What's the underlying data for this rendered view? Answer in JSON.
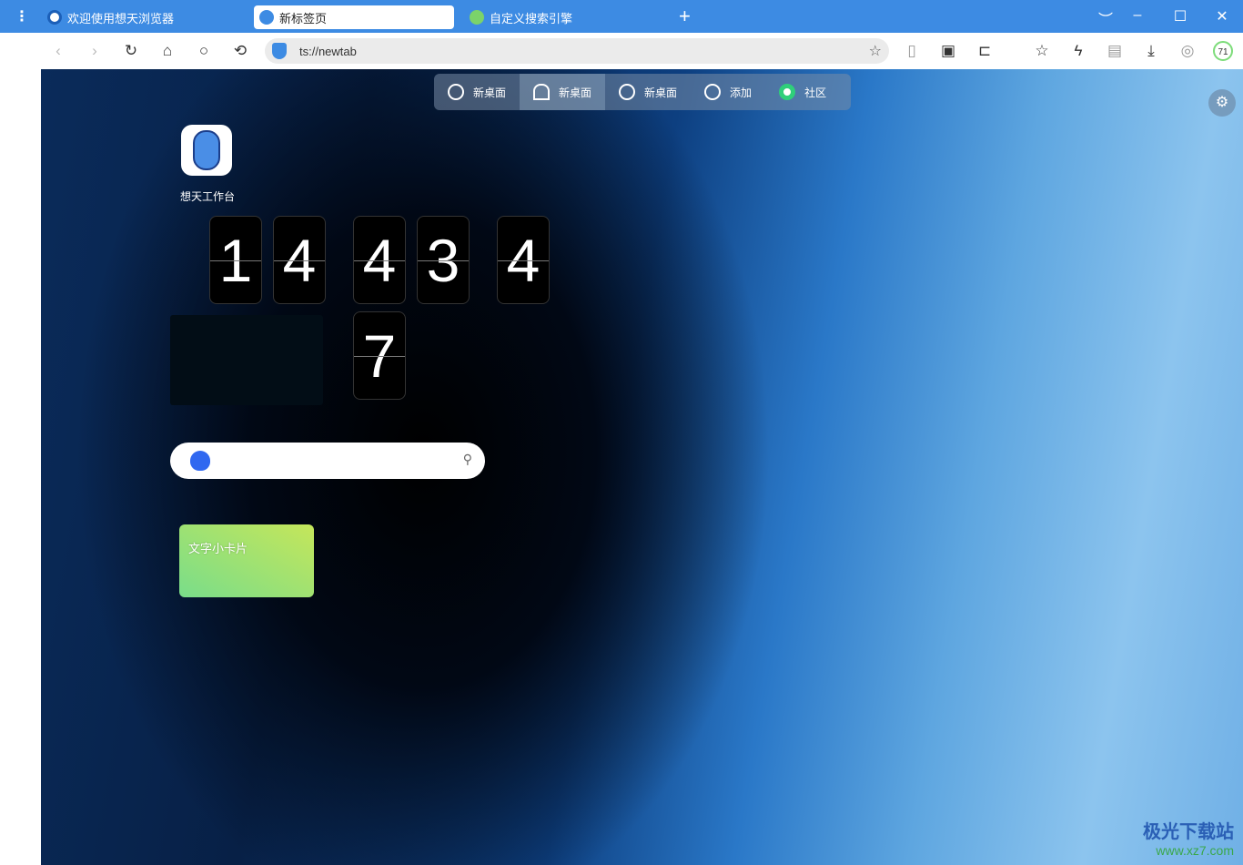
{
  "tabs": [
    {
      "label": "欢迎使用想天浏览器",
      "active": false
    },
    {
      "label": "新标签页",
      "active": true
    },
    {
      "label": "自定义搜索引擎",
      "active": false
    }
  ],
  "address": {
    "url": "ts://newtab"
  },
  "extension_badge": "71",
  "nav": [
    {
      "label": "新桌面",
      "icon": "lightbulb-icon"
    },
    {
      "label": "新桌面",
      "icon": "alarm-icon",
      "active": true
    },
    {
      "label": "新桌面",
      "icon": "compass-icon"
    },
    {
      "label": "添加",
      "icon": "plus-circle-icon"
    },
    {
      "label": "社区",
      "icon": "community-icon"
    }
  ],
  "app": {
    "label": "想天工作台"
  },
  "clock": {
    "digits": [
      "1",
      "4",
      "4",
      "3",
      "4",
      "7"
    ]
  },
  "card": {
    "label": "文字小卡片"
  },
  "watermark": {
    "name": "极光下载站",
    "url": "www.xz7.com"
  },
  "colors": {
    "tabbar": "#3d8be3",
    "card_start": "#79dd8a",
    "card_end": "#c5e65a"
  }
}
